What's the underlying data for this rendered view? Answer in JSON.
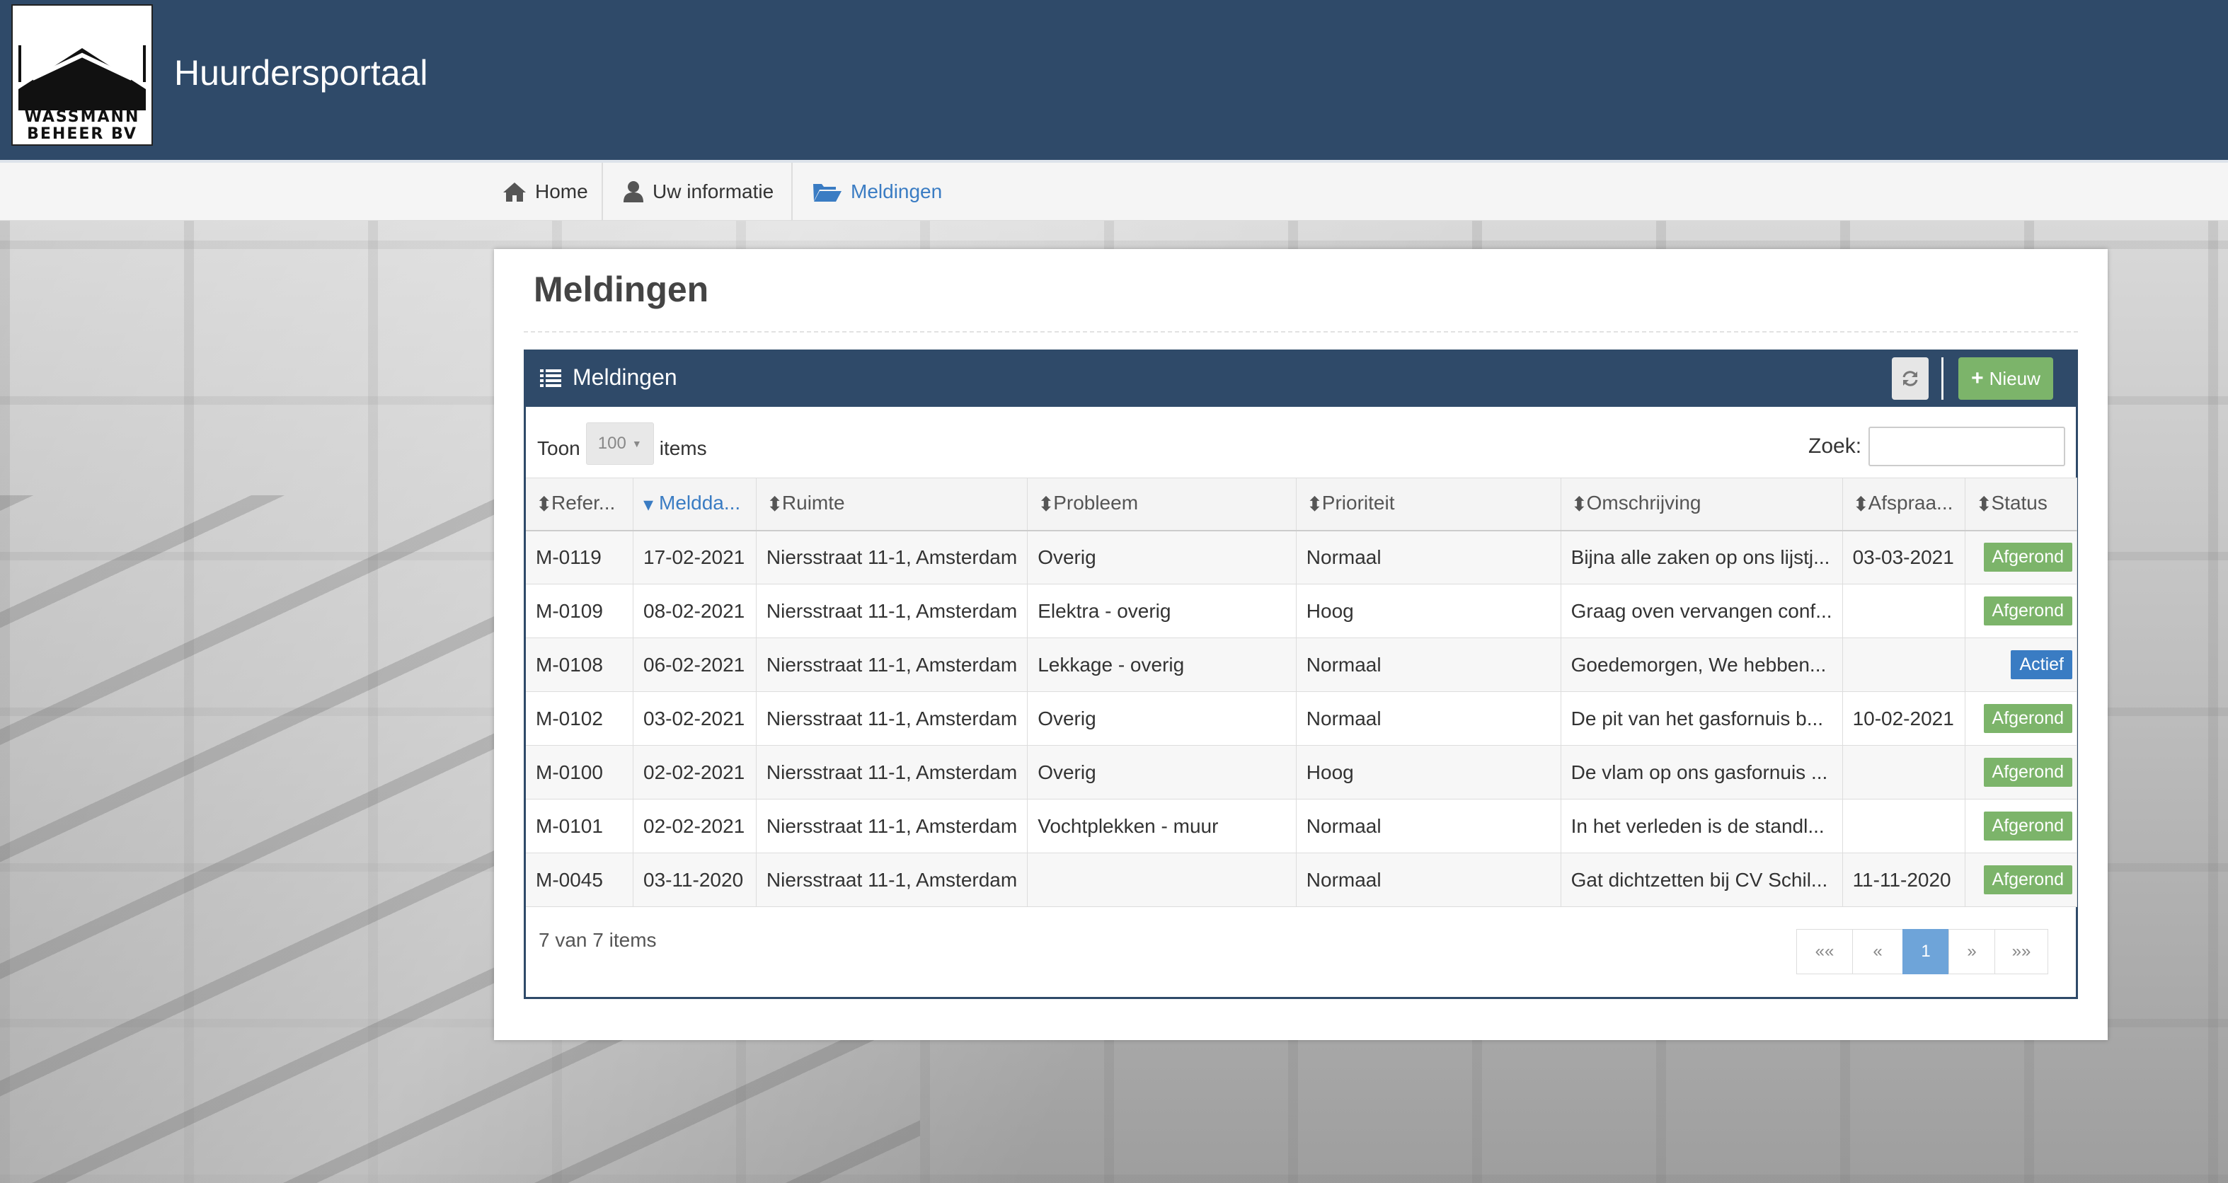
{
  "header": {
    "logo_line1": "WASSMANN",
    "logo_line2": "BEHEER BV",
    "title": "Huurdersportaal"
  },
  "nav": {
    "items": [
      {
        "label": "Home",
        "icon": "home-icon"
      },
      {
        "label": "Uw informatie",
        "icon": "user-icon"
      },
      {
        "label": "Meldingen",
        "icon": "folder-open-icon",
        "active": true
      }
    ]
  },
  "page": {
    "title": "Meldingen"
  },
  "panel": {
    "title": "Meldingen",
    "new_button": "Nieuw",
    "show_label": "Toon",
    "show_value": "100",
    "items_label": "items",
    "search_label": "Zoek:",
    "search_value": "",
    "columns": [
      "Refer...",
      "Meldda...",
      "Ruimte",
      "Probleem",
      "Prioriteit",
      "Omschrijving",
      "Afspraa...",
      "Status"
    ],
    "rows": [
      {
        "ref": "M-0119",
        "date": "17-02-2021",
        "room": "Niersstraat 11-1, Amsterdam",
        "problem": "Overig",
        "priority": "Normaal",
        "desc": "Bijna alle zaken op ons lijstj...",
        "appt": "03-03-2021",
        "status": "Afgerond"
      },
      {
        "ref": "M-0109",
        "date": "08-02-2021",
        "room": "Niersstraat 11-1, Amsterdam",
        "problem": "Elektra - overig",
        "priority": "Hoog",
        "desc": "Graag oven vervangen conf...",
        "appt": "",
        "status": "Afgerond"
      },
      {
        "ref": "M-0108",
        "date": "06-02-2021",
        "room": "Niersstraat 11-1, Amsterdam",
        "problem": "Lekkage - overig",
        "priority": "Normaal",
        "desc": "Goedemorgen, We hebben...",
        "appt": "",
        "status": "Actief"
      },
      {
        "ref": "M-0102",
        "date": "03-02-2021",
        "room": "Niersstraat 11-1, Amsterdam",
        "problem": "Overig",
        "priority": "Normaal",
        "desc": "De pit van het gasfornuis b...",
        "appt": "10-02-2021",
        "status": "Afgerond"
      },
      {
        "ref": "M-0100",
        "date": "02-02-2021",
        "room": "Niersstraat 11-1, Amsterdam",
        "problem": "Overig",
        "priority": "Hoog",
        "desc": "De vlam op ons gasfornuis ...",
        "appt": "",
        "status": "Afgerond"
      },
      {
        "ref": "M-0101",
        "date": "02-02-2021",
        "room": "Niersstraat 11-1, Amsterdam",
        "problem": "Vochtplekken - muur",
        "priority": "Normaal",
        "desc": "In het verleden is de standl...",
        "appt": "",
        "status": "Afgerond"
      },
      {
        "ref": "M-0045",
        "date": "03-11-2020",
        "room": "Niersstraat 11-1, Amsterdam",
        "problem": "",
        "priority": "Normaal",
        "desc": "Gat dichtzetten bij CV Schil...",
        "appt": "11-11-2020",
        "status": "Afgerond"
      }
    ],
    "count_text": "7 van 7 items",
    "pager": [
      "««",
      "«",
      "1",
      "»",
      "»»"
    ],
    "current_page": "1"
  },
  "colors": {
    "header_bg": "#2f4a69",
    "accent": "#3a7cc3",
    "done": "#7cb46a",
    "active": "#3a7cc3"
  }
}
